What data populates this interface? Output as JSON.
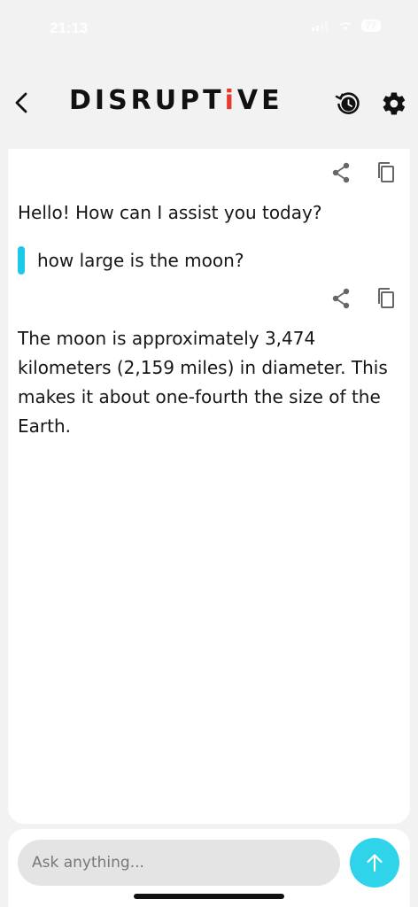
{
  "status_bar": {
    "time": "21:13",
    "battery": "77"
  },
  "header": {
    "logo_start": "DISRUPT",
    "logo_accent": "i",
    "logo_end": "VE"
  },
  "messages": [
    {
      "role": "assistant",
      "text": "Hello! How can I assist you today?"
    },
    {
      "role": "user",
      "text": "how large is the moon?"
    },
    {
      "role": "assistant",
      "text": "The moon is approximately 3,474 kilometers (2,159 miles) in diameter. This makes it about one-fourth the size of the Earth."
    }
  ],
  "composer": {
    "placeholder": "Ask anything..."
  },
  "colors": {
    "accent": "#2fd3ea",
    "user_bar": "#1ec8e8",
    "logo_accent": "#e63a2e"
  },
  "icons": [
    "back-chevron-icon",
    "history-icon",
    "gear-icon",
    "share-icon",
    "copy-icon",
    "arrow-up-icon"
  ]
}
